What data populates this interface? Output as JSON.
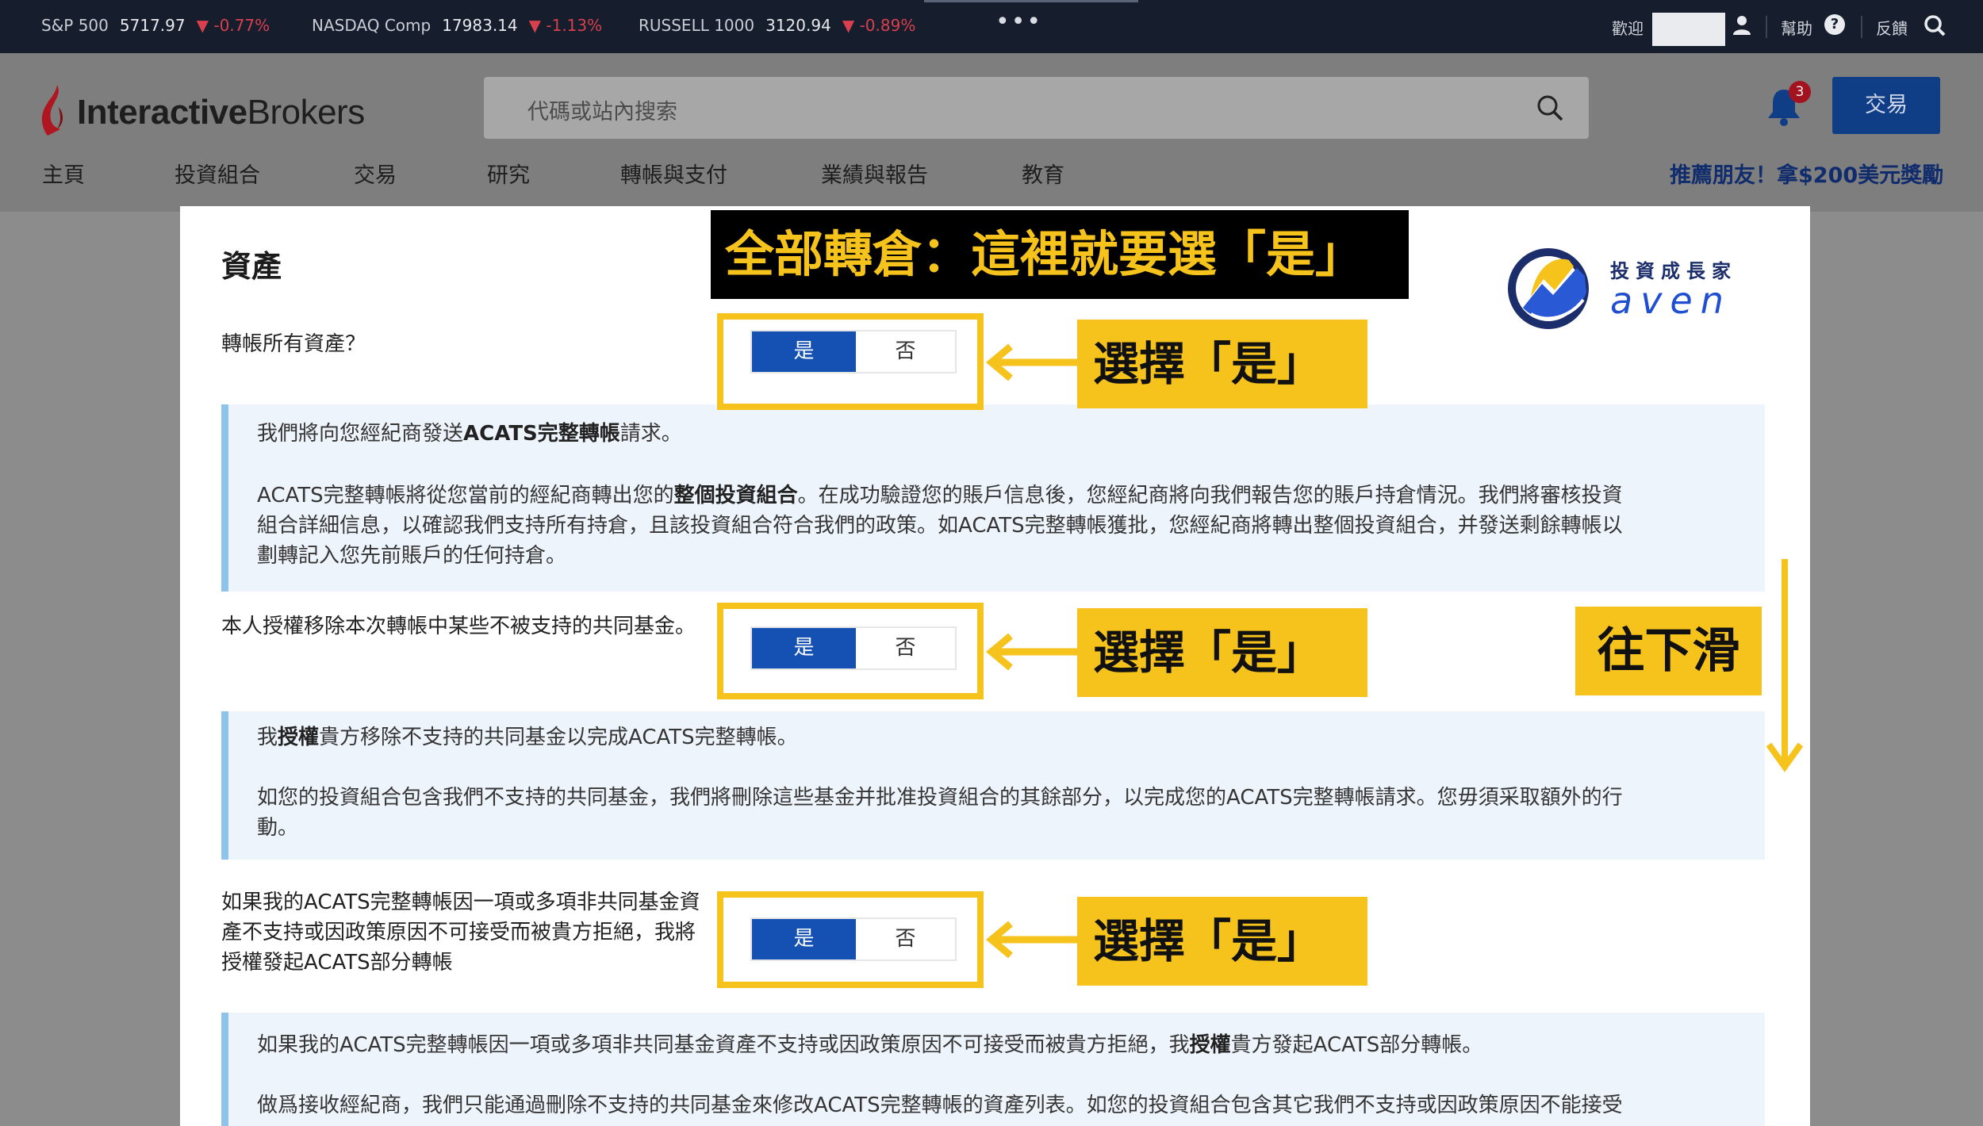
{
  "ticker": {
    "items": [
      {
        "name": "S&P 500",
        "value": "5717.97",
        "change": "▼ -0.77%"
      },
      {
        "name": "NASDAQ Comp",
        "value": "17983.14",
        "change": "▼ -1.13%"
      },
      {
        "name": "RUSSELL 1000",
        "value": "3120.94",
        "change": "▼ -0.89%"
      }
    ],
    "more": "•••",
    "welcome": "歡迎",
    "help": "幫助",
    "help_icon": "?",
    "feedback": "反饋"
  },
  "header": {
    "logo_brand_1": "Interactive",
    "logo_brand_2": "Brokers",
    "search_placeholder": "代碼或站內搜索",
    "notification_count": "3",
    "trade_button": "交易",
    "nav": [
      "主頁",
      "投資組合",
      "交易",
      "研究",
      "轉帳與支付",
      "業績與報告",
      "教育"
    ],
    "promo": "推薦朋友！拿$200美元獎勵"
  },
  "panel": {
    "title": "資產",
    "questions": [
      {
        "label": "轉帳所有資產？",
        "yes": "是",
        "no": "否"
      },
      {
        "label": "本人授權移除本次轉帳中某些不被支持的共同基金。",
        "yes": "是",
        "no": "否"
      },
      {
        "label": "如果我的ACATS完整轉帳因一項或多項非共同基金資產不支持或因政策原因不可接受而被貴方拒絕，我將授權發起ACATS部分轉帳",
        "yes": "是",
        "no": "否"
      }
    ],
    "info1": {
      "p1_a": "我們將向您經紀商發送",
      "p1_b": "ACATS完整轉帳",
      "p1_c": "請求。",
      "p2_a": "ACATS完整轉帳將從您當前的經紀商轉出您的",
      "p2_b": "整個投資組合",
      "p2_c": "。在成功驗證您的賬戶信息後，您經紀商將向我們報告您的賬戶持倉情況。我們將審核投資",
      "p2_line2": "組合詳細信息，以確認我們支持所有持倉，且該投資組合符合我們的政策。如ACATS完整轉帳獲批，您經紀商將轉出整個投資組合，并發送剩餘轉帳以",
      "p2_line3": "劃轉記入您先前賬戶的任何持倉。"
    },
    "info2": {
      "p1_a": "我",
      "p1_b": "授權",
      "p1_c": "貴方移除不支持的共同基金以完成ACATS完整轉帳。",
      "p2_line1": "如您的投資組合包含我們不支持的共同基金，我們將刪除這些基金并批准投資組合的其餘部分，以完成您的ACATS完整轉帳請求。您毋須采取額外的行",
      "p2_line2": "動。"
    },
    "info3": {
      "p1_a": "如果我的ACATS完整轉帳因一項或多項非共同基金資產不支持或因政策原因不可接受而被貴方拒絕，我",
      "p1_b": "授權",
      "p1_c": "貴方發起ACATS部分轉帳。",
      "p2_line1": "做爲接收經紀商，我們只能通過刪除不支持的共同基金來修改ACATS完整轉帳的資產列表。如您的投資組合包含其它我們不支持或因政策原因不能接受"
    }
  },
  "annotations": {
    "banner": "全部轉倉：這裡就要選「是」",
    "callout": "選擇「是」",
    "scroll": "往下滑",
    "brand_cn": "投資成長家",
    "brand_en": "aven",
    "highlight_color": "#f6c21c"
  }
}
